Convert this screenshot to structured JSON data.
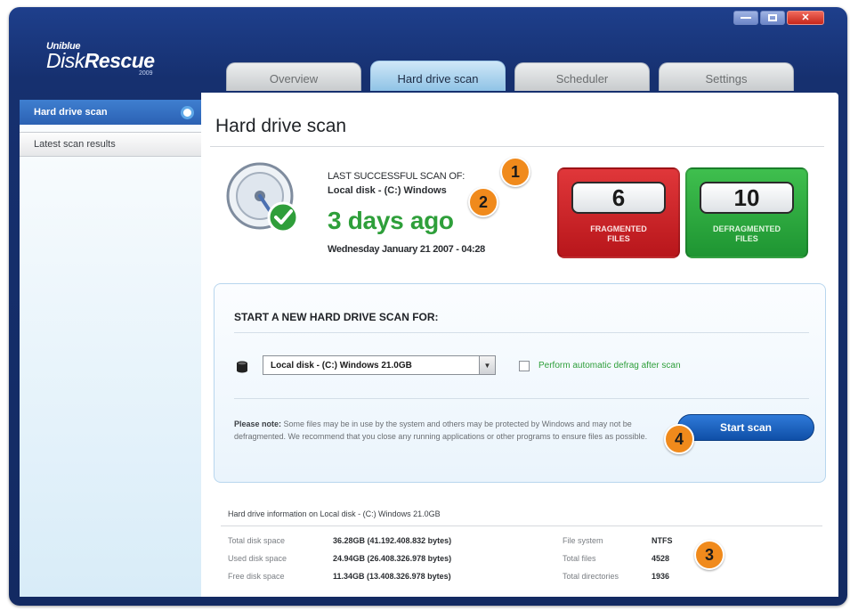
{
  "app": {
    "brand": "Uniblue",
    "product_a": "Disk",
    "product_b": "Rescue",
    "year": "2009"
  },
  "tabs": [
    {
      "label": "Overview"
    },
    {
      "label": "Hard drive scan"
    },
    {
      "label": "Scheduler"
    },
    {
      "label": "Settings"
    }
  ],
  "sidebar": {
    "items": [
      {
        "label": "Hard drive scan"
      },
      {
        "label": "Latest scan results"
      }
    ]
  },
  "main": {
    "title": "Hard drive scan",
    "last_scan": {
      "label": "LAST SUCCESSFUL SCAN OF:",
      "disk": "Local disk - (C:) Windows",
      "ago": "3 days ago",
      "date": "Wednesday January 21 2007 - 04:28"
    },
    "stats": {
      "fragmented_value": "6",
      "fragmented_label_1": "FRAGMENTED",
      "fragmented_label_2": "FILES",
      "defragmented_value": "10",
      "defragmented_label_1": "DEFRAGMENTED",
      "defragmented_label_2": "FILES"
    },
    "new_scan": {
      "heading": "START A NEW HARD DRIVE SCAN FOR:",
      "selected_disk": "Local disk - (C:) Windows 21.0GB",
      "checkbox_label": "Perform automatic defrag after scan",
      "note_bold": "Please note:",
      "note_text": "Some files may be in use by the system and others may be protected by Windows and may not be defragmented. We recommend that you close any running applications or other programs to ensure files as possible.",
      "start_label": "Start scan"
    },
    "info": {
      "title": "Hard drive information on Local disk - (C:) Windows 21.0GB",
      "rows": [
        {
          "k1": "Total disk space",
          "v1": "36.28GB (41.192.408.832 bytes)",
          "k2": "File system",
          "v2": "NTFS"
        },
        {
          "k1": "Used disk space",
          "v1": "24.94GB (26.408.326.978 bytes)",
          "k2": "Total files",
          "v2": "4528"
        },
        {
          "k1": "Free disk space",
          "v1": "11.34GB (13.408.326.978 bytes)",
          "k2": "Total directories",
          "v2": "1936"
        }
      ]
    }
  },
  "badges": [
    "1",
    "2",
    "3",
    "4"
  ],
  "colors": {
    "frame": "#16306f",
    "accent_green": "#2e9f3a",
    "stat_red": "#c9262a",
    "stat_green": "#2aa63e",
    "badge_orange": "#f08a1c",
    "button_blue": "#1f63c0"
  }
}
